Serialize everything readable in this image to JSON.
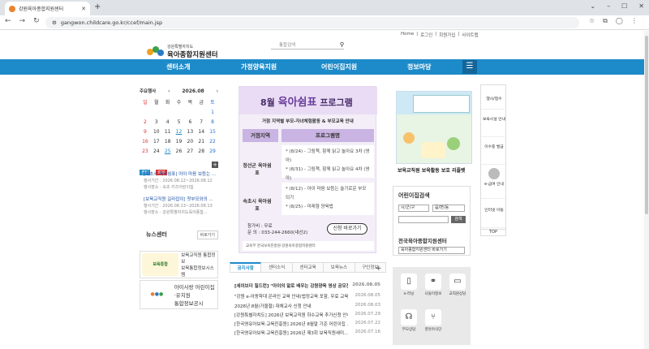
{
  "browser": {
    "tab_title": "강원육아종합지원센터",
    "url": "gangwon.childcare.go.kr/ccef/main.jsp"
  },
  "util_links": [
    "Home",
    "로그인",
    "회원가입",
    "사이트맵"
  ],
  "logo": {
    "sub": "강원특별자치도",
    "main": "육아종합지원센터"
  },
  "search_placeholder": "통합검색",
  "gnb": [
    "센터소개",
    "가정양육지원",
    "어린이집지원",
    "정보마당"
  ],
  "calendar": {
    "label": "주요행사",
    "month": "2026.08",
    "weekdays": [
      "일",
      "월",
      "화",
      "수",
      "목",
      "금",
      "토"
    ],
    "days": [
      "",
      "",
      "",
      "",
      "",
      "",
      "1",
      "2",
      "3",
      "4",
      "5",
      "6",
      "7",
      "8",
      "9",
      "10",
      "11",
      "12",
      "13",
      "14",
      "15",
      "16",
      "17",
      "18",
      "19",
      "20",
      "21",
      "22",
      "23",
      "24",
      "25",
      "26",
      "27",
      "28",
      "29"
    ]
  },
  "events_tags": [
    "센터",
    "외부"
  ],
  "events": [
    {
      "title": "[속초시 육아쉼표] 아이 마음 보듬는 ...",
      "period": "행사기간 : 2026.08.12~2026.08.12",
      "place": "행사장소 : 속초 키즈어린이집"
    },
    {
      "title": "[보육교직원 길라잡이] 첫부모와의 ...",
      "period": "행사기간 : 2026.08.13~2026.08.13",
      "place": "행사장소 : 강원특별자치도육아종합..."
    }
  ],
  "news": {
    "title": "뉴스센터",
    "more": "바로가기",
    "items": [
      "보육교직원 통합정보\n보육통합정보시스템",
      "아이사랑 어린이집·유치원\n통합정보공시"
    ]
  },
  "poster": {
    "month": "8월",
    "title": "육아쉼표",
    "title_tail": "프로그램",
    "subtitle": "거점 지역별 부모-자녀체험활동 & 부모교육 안내",
    "col_region": "거점지역",
    "col_program": "프로그램명",
    "rows": [
      {
        "region": "정선군 육아쉼표",
        "lines": [
          "* (8/24) - 그림책, 함께 읽고 놀아요 3차 (영아)",
          "* (8/31) - 그림책, 함께 읽고 놀아요 4차 (영아)"
        ]
      },
      {
        "region": "속초시 육아쉼표",
        "lines": [
          "* (8/12) - 아이 마음 보듬는 슬기로운 부모되기",
          "* (8/25) - 미래형 양육법"
        ]
      }
    ],
    "fee": "참가비 : 무료",
    "tel": "문    의 : 033-244-2660(내선2)",
    "apply": "신청 바로가기",
    "footer": "교육부    한국보육진흥원·강원육아종합지원센터"
  },
  "board": {
    "tabs": [
      "공지사항",
      "센터소식",
      "센터교육",
      "보육뉴스",
      "구인정보"
    ],
    "items": [
      {
        "title": "[세이브더 칠드런] \"아이의 말로 배우는 강원양육 영상 공모전...",
        "date": "2026.08.05"
      },
      {
        "title": "\"강원 e-아동학대 온라인 교육 안내(법정교육 포함, 무료 교육)",
        "date": "2026.08.05"
      },
      {
        "title": "2026년 8월(가을철) 대체교사 신청 안내",
        "date": "2026.08.03"
      },
      {
        "title": "[강원특별자치도] 2026년 보육교직원 하수교육 추가신청 안내 ...",
        "date": "2026.07.29"
      },
      {
        "title": "[한국영유아보육·교육진흥원] 2026년 8월말 기준 어린이집 ...",
        "date": "2026.07.22"
      },
      {
        "title": "[한국영유아보육·교육진흥원] 2026년 제3회 보육직원세미...",
        "date": "2026.07.16"
      }
    ]
  },
  "right_banner_caption": "보육교직원 보육활동 보호 리플렛",
  "daycare_search": {
    "title": "어린이집검색",
    "sel1": "시/군/구",
    "sel2": "읍/면/동",
    "button": "검색"
  },
  "center_title": "전국육아종합지원센터",
  "center_select": "육아종합지원센터 바로가기",
  "quick": [
    "e-러닝",
    "나들이정보",
    "교직원상담",
    "부모상담",
    "영유아식단"
  ],
  "side_menu": [
    "행사/접수",
    "보육시설 안내",
    "이수증 발급",
    "e-급여 안내",
    "인터넷 아동",
    "TOP"
  ]
}
